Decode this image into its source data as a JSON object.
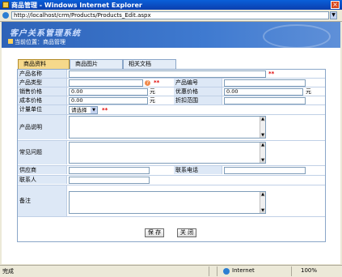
{
  "window": {
    "title": "商品管理 - Windows Internet Explorer",
    "close_glyph": "×"
  },
  "address": {
    "url": "http://localhost/crm/Products/Products_Edit.aspx"
  },
  "banner": {
    "system_title": "客户关系管理系统",
    "location": "当前位置：商品管理"
  },
  "tabs": [
    {
      "label": "商品资料",
      "active": true
    },
    {
      "label": "商品图片",
      "active": false
    },
    {
      "label": "相关文档",
      "active": false
    }
  ],
  "form": {
    "product_name_label": "产品名称",
    "product_type_label": "产品类型",
    "product_code_label": "产品编号",
    "sale_price_label": "销售价格",
    "sale_price_value": "0.00",
    "discount_price_label": "优惠价格",
    "discount_price_value": "0.00",
    "cost_price_label": "成本价格",
    "cost_price_value": "0.00",
    "discount_range_label": "折扣范围",
    "unit_label": "计量单位",
    "unit_select_value": "请选择",
    "description_label": "产品说明",
    "faq_label": "常见问题",
    "supplier_label": "供应商",
    "contact_phone_label": "联系电话",
    "contact_label": "联系人",
    "remark_label": "备注",
    "currency_unit": "元",
    "required_mark": "**",
    "help_glyph": "?"
  },
  "buttons": {
    "save": "保 存",
    "close": "关 闭"
  },
  "status": {
    "text": "完成",
    "zone": "Internet",
    "zoom": "100%"
  }
}
